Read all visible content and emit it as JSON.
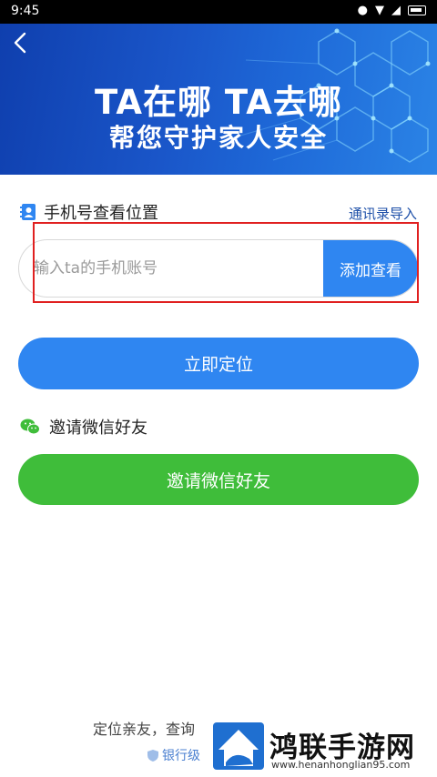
{
  "status_bar": {
    "time": "9:45",
    "left_icons": [
      "alert-icon",
      "image-icon",
      "image-icon",
      "dot-icon"
    ],
    "right_icons": [
      "location-icon",
      "wifi-icon",
      "signal-icon",
      "battery-icon"
    ]
  },
  "banner": {
    "title": "TA在哪  TA去哪",
    "subtitle": "帮您守护家人安全"
  },
  "phone_section": {
    "title": "手机号查看位置",
    "import_link": "通讯录导入",
    "input_placeholder": "输入ta的手机账号",
    "add_button": "添加查看"
  },
  "locate_button": "立即定位",
  "invite_section": {
    "title": "邀请微信好友",
    "button": "邀请微信好友"
  },
  "footer": {
    "text": "定位亲友，查询",
    "sub_text": "银行级"
  },
  "watermark": {
    "name": "鸿联手游网",
    "url": "www.henanhonglian95.com"
  },
  "colors": {
    "primary_blue": "#2f86f1",
    "invite_green": "#3fbd3a",
    "link_blue": "#1d4fa8",
    "highlight_red": "#e02020"
  }
}
